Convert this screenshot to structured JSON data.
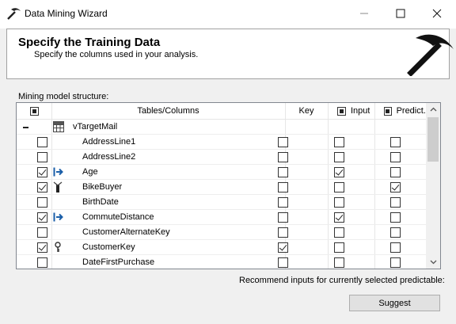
{
  "window": {
    "title": "Data Mining Wizard"
  },
  "header": {
    "title": "Specify the Training Data",
    "subtitle": "Specify the columns used in your analysis."
  },
  "structure": {
    "label": "Mining model structure:",
    "columns": {
      "select_all_checked": true,
      "tables_columns": "Tables/Columns",
      "key": "Key",
      "input": "Input",
      "predict": "Predict..."
    },
    "table_name": "vTargetMail",
    "rows": [
      {
        "name": "AddressLine1",
        "selected": false,
        "icon": "",
        "key": false,
        "input": false,
        "predict": false
      },
      {
        "name": "AddressLine2",
        "selected": false,
        "icon": "",
        "key": false,
        "input": false,
        "predict": false
      },
      {
        "name": "Age",
        "selected": true,
        "icon": "input-arrow-icon",
        "key": false,
        "input": true,
        "predict": false
      },
      {
        "name": "BikeBuyer",
        "selected": true,
        "icon": "predict-icon",
        "key": false,
        "input": false,
        "predict": true
      },
      {
        "name": "BirthDate",
        "selected": false,
        "icon": "",
        "key": false,
        "input": false,
        "predict": false
      },
      {
        "name": "CommuteDistance",
        "selected": true,
        "icon": "input-arrow-icon",
        "key": false,
        "input": true,
        "predict": false
      },
      {
        "name": "CustomerAlternateKey",
        "selected": false,
        "icon": "",
        "key": false,
        "input": false,
        "predict": false
      },
      {
        "name": "CustomerKey",
        "selected": true,
        "icon": "key-icon",
        "key": true,
        "input": false,
        "predict": false
      },
      {
        "name": "DateFirstPurchase",
        "selected": false,
        "icon": "",
        "key": false,
        "input": false,
        "predict": false
      }
    ]
  },
  "recommend": {
    "label": "Recommend inputs for currently selected predictable:",
    "button_label": "Suggest"
  }
}
